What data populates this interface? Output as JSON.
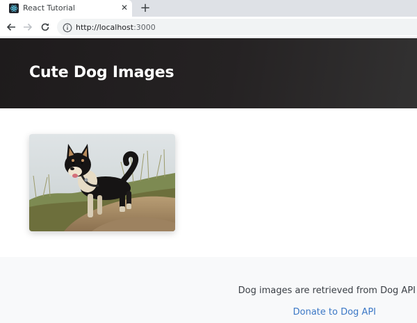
{
  "browser": {
    "tab_title": "React Tutorial",
    "close_glyph": "✕",
    "new_tab_glyph": "+",
    "url_host": "http://localhost",
    "url_rest": ":3000",
    "icons": [
      "react-favicon-icon",
      "close-icon",
      "plus-icon",
      "back-arrow-icon",
      "forward-arrow-icon",
      "reload-icon",
      "info-icon"
    ]
  },
  "page": {
    "title": "Cute Dog Images",
    "image_alt_subject": "shiba-inu-dog-photo",
    "footer_note": "Dog images are retrieved from Dog API",
    "donate_link": "Donate to Dog API"
  },
  "colors": {
    "hero_bg": "#221f20",
    "footer_bg": "#f8f9fa",
    "link": "#3b78c6",
    "tabstrip": "#dee1e6"
  }
}
